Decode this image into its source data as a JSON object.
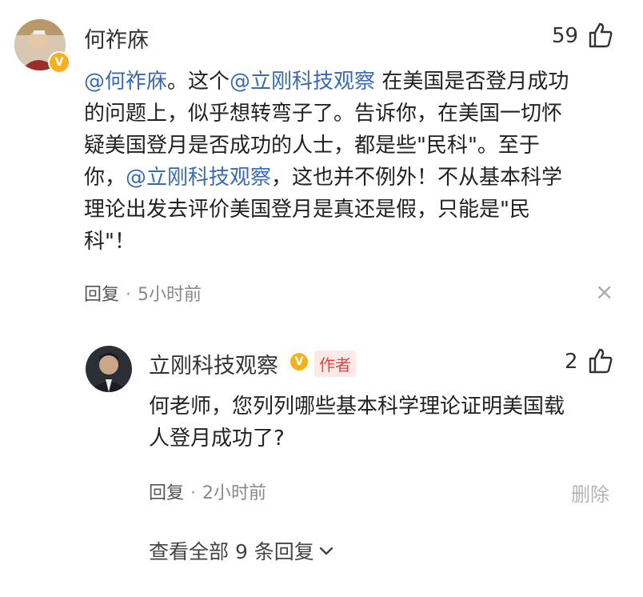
{
  "comment": {
    "author": "何祚庥",
    "likes": "59",
    "mention_author": "@何祚庥",
    "body_sep1": "。这个",
    "mention_account": "@立刚科技观察",
    "body_1": "在美国是否登月成功",
    "body_2": "的问题上，似乎想转弯子了。告诉你，在美国一切怀",
    "body_3": "疑美国登月是否成功的人士，都是些\"民科\"。至于",
    "body_4a": "你，",
    "body_4_mention": "@立刚科技观察",
    "body_4b": "，这也并不例外！不从基本科学",
    "body_5": "理论出发去评价美国登月是真还是假，只能是\"民",
    "body_6": "科\"！",
    "reply_label": "回复",
    "dot": "·",
    "time": "5小时前"
  },
  "reply": {
    "author": "立刚科技观察",
    "author_tag": "作者",
    "likes": "2",
    "body_1": "何老师，您列列哪些基本科学理论证明美国载",
    "body_2": "人登月成功了?",
    "reply_label": "回复",
    "dot": "·",
    "time": "2小时前",
    "delete_label": "删除"
  },
  "view_all": "查看全部 9 条回复",
  "close_glyph": "×",
  "badge_glyph": "V",
  "colors": {
    "mention": "#3a6bb0",
    "tag_text": "#e8423b",
    "tag_bg": "#fde9e8",
    "badge": "#f5b01c"
  },
  "icons": [
    "thumbs-up-icon",
    "verified-badge-icon",
    "close-icon",
    "chevron-down-icon"
  ]
}
